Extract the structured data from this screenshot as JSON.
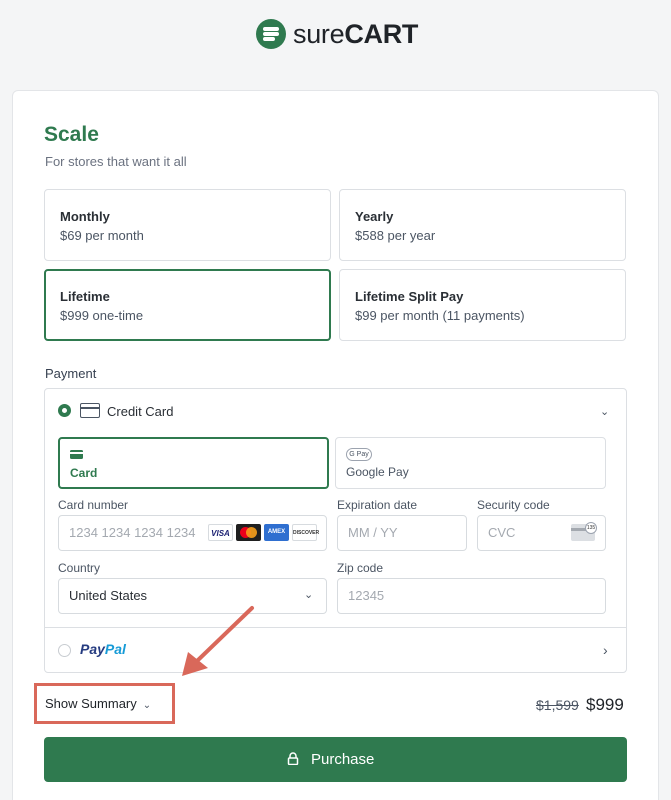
{
  "brand": {
    "logo_part1": "sure",
    "logo_part2": "CART"
  },
  "product": {
    "title": "Scale",
    "subtitle": "For stores that want it all"
  },
  "plans": [
    {
      "name": "Monthly",
      "price": "$69 per month",
      "selected": false
    },
    {
      "name": "Yearly",
      "price": "$588 per year",
      "selected": false
    },
    {
      "name": "Lifetime",
      "price": "$999 one-time",
      "selected": true
    },
    {
      "name": "Lifetime Split Pay",
      "price": "$99 per month (11 payments)",
      "selected": false
    }
  ],
  "payment": {
    "section_label": "Payment",
    "credit_card_label": "Credit Card",
    "tabs": {
      "card": "Card",
      "google_pay": "Google Pay",
      "gpay_badge": "G Pay"
    },
    "card_number": {
      "label": "Card number",
      "placeholder": "1234 1234 1234 1234"
    },
    "expiration": {
      "label": "Expiration date",
      "placeholder": "MM / YY"
    },
    "security": {
      "label": "Security code",
      "placeholder": "CVC",
      "badge": "135"
    },
    "country": {
      "label": "Country",
      "value": "United States"
    },
    "zip": {
      "label": "Zip code",
      "placeholder": "12345"
    },
    "card_brands": {
      "visa": "VISA",
      "amex": "AMEX",
      "discover": "DISCOVER"
    },
    "paypal": {
      "part1": "Pay",
      "part2": "Pal"
    }
  },
  "summary": {
    "toggle_label": "Show Summary",
    "original_price": "$1,599",
    "price": "$999"
  },
  "purchase_label": "Purchase",
  "colors": {
    "accent": "#2f7a4f",
    "annotation": "#d9685a"
  },
  "icons": [
    "logo-icon",
    "credit-card-icon",
    "chevron-down-icon",
    "chevron-right-icon",
    "card-icon",
    "google-pay-icon",
    "lock-icon",
    "paypal-icon",
    "arrow-annotation"
  ]
}
